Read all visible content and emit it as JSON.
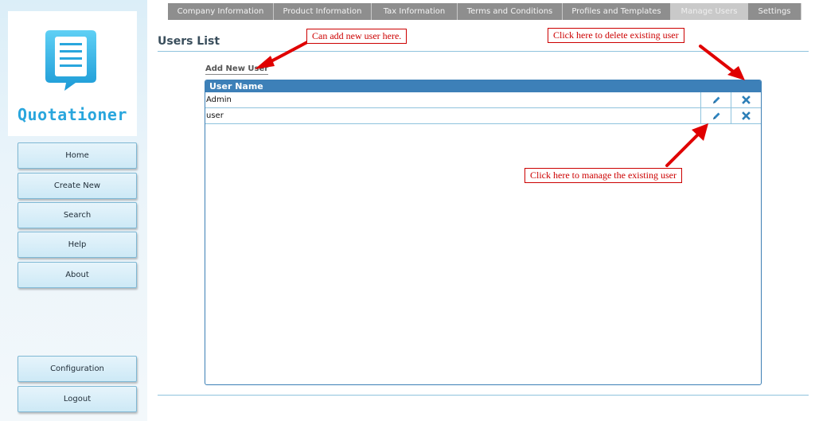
{
  "app": {
    "logo_text": "Quotationer"
  },
  "tabs": [
    {
      "label": "Company Information",
      "active": false
    },
    {
      "label": "Product Information",
      "active": false
    },
    {
      "label": "Tax Information",
      "active": false
    },
    {
      "label": "Terms and Conditions",
      "active": false
    },
    {
      "label": "Profiles and Templates",
      "active": false
    },
    {
      "label": "Manage Users",
      "active": true
    },
    {
      "label": "Settings",
      "active": false
    }
  ],
  "sidebar": {
    "nav": [
      "Home",
      "Create New",
      "Search",
      "Help",
      "About"
    ],
    "bottom": [
      "Configuration",
      "Logout"
    ]
  },
  "main": {
    "title": "Users List",
    "add_user_label": "Add New User",
    "grid": {
      "column_header": "User Name",
      "rows": [
        {
          "name": "Admin"
        },
        {
          "name": "user"
        }
      ]
    }
  },
  "callouts": {
    "add_user": "Can add new user here.",
    "delete_user": "Click here to delete existing user",
    "manage_user": "Click here to manage the existing user"
  },
  "colors": {
    "accent": "#3d80b8",
    "logo": "#29a6dd",
    "callout": "#cc0000"
  },
  "icons": {
    "edit": "pencil-icon",
    "delete": "x-icon"
  }
}
